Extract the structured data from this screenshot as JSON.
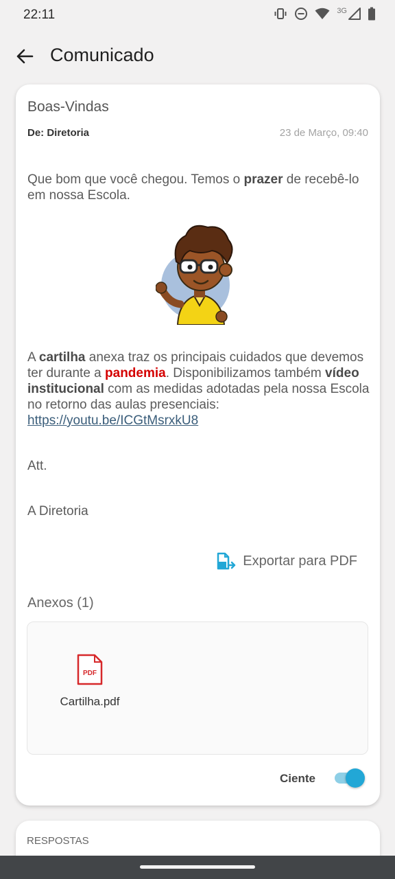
{
  "status_bar": {
    "time": "22:11",
    "network": "3G",
    "icons": [
      "vibrate-icon",
      "do-not-disturb-icon",
      "wifi-icon",
      "signal-icon",
      "battery-icon"
    ]
  },
  "app_bar": {
    "back_icon": "arrow-left-icon",
    "title": "Comunicado"
  },
  "message": {
    "title": "Boas-Vindas",
    "from": "De: Diretoria",
    "date": "23 de Março, 09:40",
    "paragraph1": {
      "t1": "Que bom que você chegou. Temos o ",
      "b1": "prazer",
      "t2": " de recebê-lo em nossa Escola."
    },
    "image": "cartoon-student-mascot",
    "paragraph2": {
      "t1": "A ",
      "b1": "cartilha",
      "t2": " anexa traz os principais cuidados que devemos ter durante a ",
      "red": "pandemia",
      "t3": ". Disponibilizamos também ",
      "b2": "vídeo institucional",
      "t4": " com as medidas adotadas pela nossa Escola no retorno das aulas presenciais: ",
      "link": "https://youtu.be/ICGtMsrxkU8"
    },
    "closing": "Att.",
    "signature": "A Diretoria"
  },
  "export": {
    "label": "Exportar para PDF",
    "icon": "export-pdf-icon"
  },
  "attachments": {
    "title": "Anexos (1)",
    "files": [
      {
        "name": "Cartilha.pdf",
        "icon_text": "PDF",
        "icon": "pdf-file-icon"
      }
    ]
  },
  "acknowledge": {
    "label": "Ciente",
    "checked": true
  },
  "responses": {
    "title": "RESPOSTAS"
  },
  "colors": {
    "accent": "#22a7d6",
    "highlight_red": "#d40000",
    "link": "#3a5d7a",
    "pdf_red": "#d6282a"
  }
}
